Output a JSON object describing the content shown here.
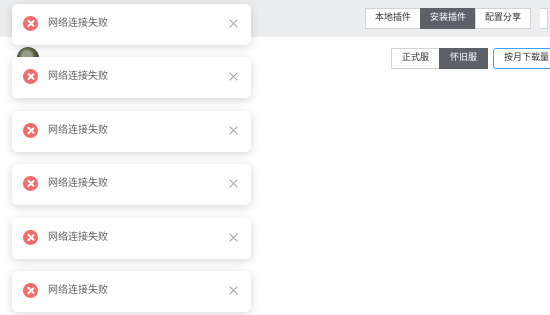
{
  "header": {
    "tabs": [
      {
        "label": "本地插件",
        "active": false
      },
      {
        "label": "安装插件",
        "active": true
      },
      {
        "label": "配置分享",
        "active": false
      }
    ]
  },
  "filters": {
    "servers": [
      {
        "label": "正式服",
        "active": false
      },
      {
        "label": "怀旧服",
        "active": true
      }
    ],
    "sort_label": "按月下载量"
  },
  "notifications": [
    {
      "type": "error",
      "icon": "error-circle-icon",
      "message": "网络连接失败"
    },
    {
      "type": "error",
      "icon": "error-circle-icon",
      "message": "网络连接失败"
    },
    {
      "type": "error",
      "icon": "error-circle-icon",
      "message": "网络连接失败"
    },
    {
      "type": "error",
      "icon": "error-circle-icon",
      "message": "网络连接失败"
    },
    {
      "type": "error",
      "icon": "error-circle-icon",
      "message": "网络连接失败"
    },
    {
      "type": "error",
      "icon": "error-circle-icon",
      "message": "网络连接失败"
    }
  ],
  "colors": {
    "error": "#f56c6c",
    "active_tab": "#5d6066",
    "accent_border": "#409eff"
  }
}
